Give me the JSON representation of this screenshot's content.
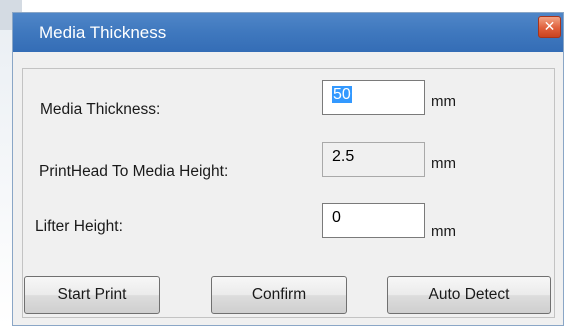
{
  "window": {
    "title": "Media Thickness",
    "close_glyph": "✕"
  },
  "fields": {
    "media_thickness": {
      "label": "Media Thickness:",
      "value": "50",
      "unit": "mm"
    },
    "printhead_height": {
      "label": "PrintHead To Media Height:",
      "value": "2.5",
      "unit": "mm"
    },
    "lifter_height": {
      "label": "Lifter Height:",
      "value": "0",
      "unit": "mm"
    }
  },
  "buttons": {
    "start_print": "Start Print",
    "confirm": "Confirm",
    "auto_detect": "Auto Detect"
  },
  "colors": {
    "titlebar": "#3f78be",
    "close_button": "#e0603c",
    "selection": "#3399ff"
  }
}
